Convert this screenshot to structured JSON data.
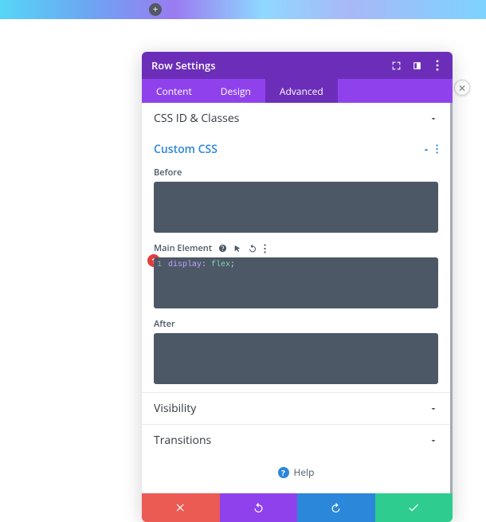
{
  "banner": {},
  "modal": {
    "title": "Row Settings",
    "tabs": {
      "content": "Content",
      "design": "Design",
      "advanced": "Advanced",
      "active": "advanced"
    },
    "sections": {
      "css_id_classes": {
        "title": "CSS ID & Classes"
      },
      "custom_css": {
        "title": "Custom CSS",
        "fields": {
          "before": {
            "label": "Before",
            "code": ""
          },
          "main_element": {
            "label": "Main Element",
            "code_line_number": "1",
            "code_keyword": "display",
            "code_sep": ": ",
            "code_value": "flex",
            "code_end": ";",
            "badge": "1"
          },
          "after": {
            "label": "After",
            "code": ""
          }
        }
      },
      "visibility": {
        "title": "Visibility"
      },
      "transitions": {
        "title": "Transitions"
      }
    },
    "help_label": "Help"
  }
}
